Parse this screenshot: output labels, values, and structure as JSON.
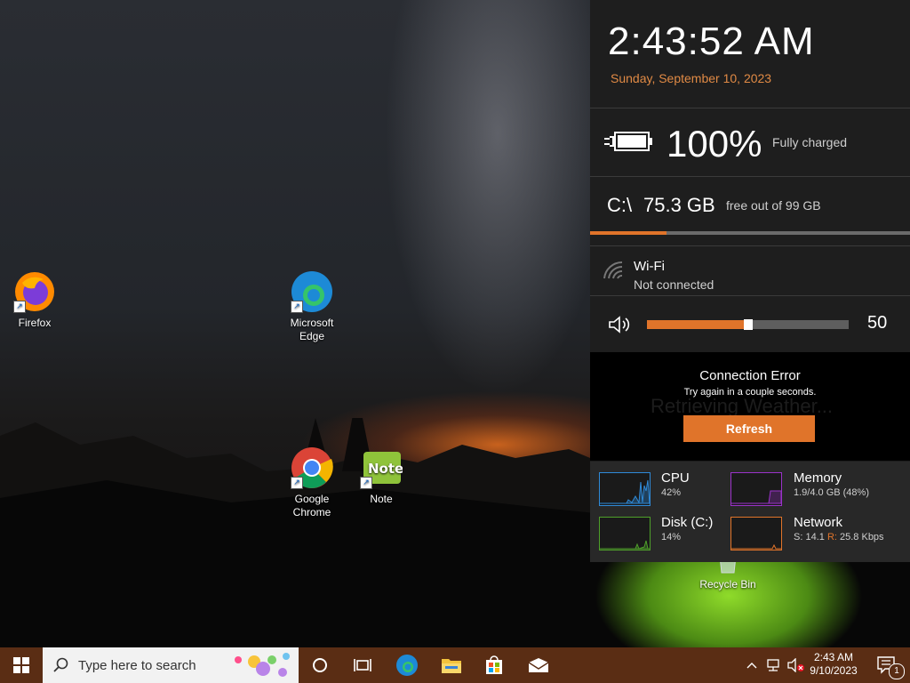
{
  "desktop": {
    "icons": [
      {
        "label": "Firefox"
      },
      {
        "label": "Microsoft Edge"
      },
      {
        "label": "Google Chrome"
      },
      {
        "label": "Note"
      },
      {
        "label": "Recycle Bin"
      }
    ]
  },
  "widgets": {
    "clock": {
      "time": "2:43:52 AM",
      "date": "Sunday, September 10, 2023"
    },
    "battery": {
      "percent": "100%",
      "status": "Fully charged",
      "level": 1.0
    },
    "disk": {
      "drive": "C:\\",
      "free": "75.3 GB",
      "total_text": "free out of 99 GB",
      "used_fraction": 0.24
    },
    "wifi": {
      "name": "Wi-Fi",
      "status": "Not connected"
    },
    "volume": {
      "value": "50",
      "level": 0.5
    },
    "weather": {
      "error_title": "Connection Error",
      "error_message": "Try again in a couple seconds.",
      "background_text": "Retrieving Weather...",
      "refresh_label": "Refresh"
    },
    "performance": {
      "cpu": {
        "name": "CPU",
        "value": "42%",
        "color": "#2f8ad8"
      },
      "memory": {
        "name": "Memory",
        "value": "1.9/4.0 GB (48%)",
        "color": "#9b32c9"
      },
      "disk": {
        "name": "Disk (C:)",
        "value": "14%",
        "color": "#4fa02a"
      },
      "network": {
        "name": "Network",
        "send_label": "S:",
        "send_value": "14.1",
        "recv_label": "R:",
        "recv_value": "25.8 Kbps",
        "color": "#e0742a"
      }
    }
  },
  "taskbar": {
    "search_placeholder": "Type here to search",
    "clock_time": "2:43 AM",
    "clock_date": "9/10/2023",
    "notification_count": "1",
    "accent": "#5a2d14"
  },
  "colors": {
    "accent": "#e0742a",
    "panel_bg": "#1e1e1e"
  }
}
